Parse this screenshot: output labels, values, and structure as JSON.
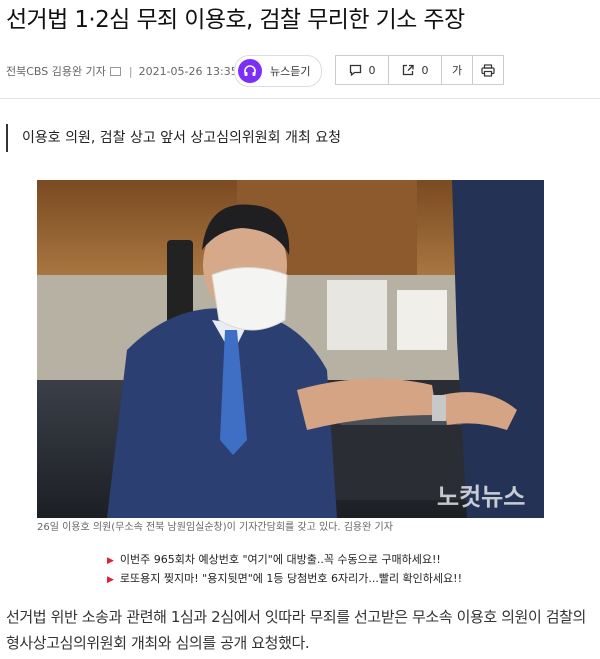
{
  "article": {
    "headline": "선거법 1·2심 무죄 이용호, 검찰 무리한 기소 주장",
    "byline": "전북CBS 김용완 기자",
    "separator": "|",
    "datetime": "2021-05-26 13:35",
    "subheadline": "이용호 의원, 검찰 상고 앞서 상고심의위원회 개최 요청",
    "photo_caption": "26일 이용호 의원(무소속 전북 남원임실순창)이 기자간담회를 갖고 있다. 김용완 기자",
    "photo_watermark": "노컷뉴스",
    "body_paragraph": "선거법 위반 소송과 관련해 1심과 2심에서 잇따라 무죄를 선고받은 무소속 이용호 의원이 검찰의 형사상고심의위원회 개최와 심의를 공개 요청했다."
  },
  "toolbar": {
    "listen_label": "뉴스듣기",
    "comment_count": "0",
    "share_count": "0",
    "font_label": "가"
  },
  "promos": [
    "이번주 965회차 예상번호 \"여기\"에 대방출..꼭 수동으로 구매하세요!!",
    "로또용지 찢지마! \"용지뒷면\"에 1등 당첨번호 6자리가...빨리 확인하세요!!"
  ],
  "colors": {
    "listen_accent": "#7b2ff7",
    "promo_bullet": "#dd2233"
  },
  "icons": {
    "byline": "mail-icon",
    "listen": "headphones-icon",
    "comment": "comment-icon",
    "share": "share-icon",
    "print": "print-icon"
  }
}
